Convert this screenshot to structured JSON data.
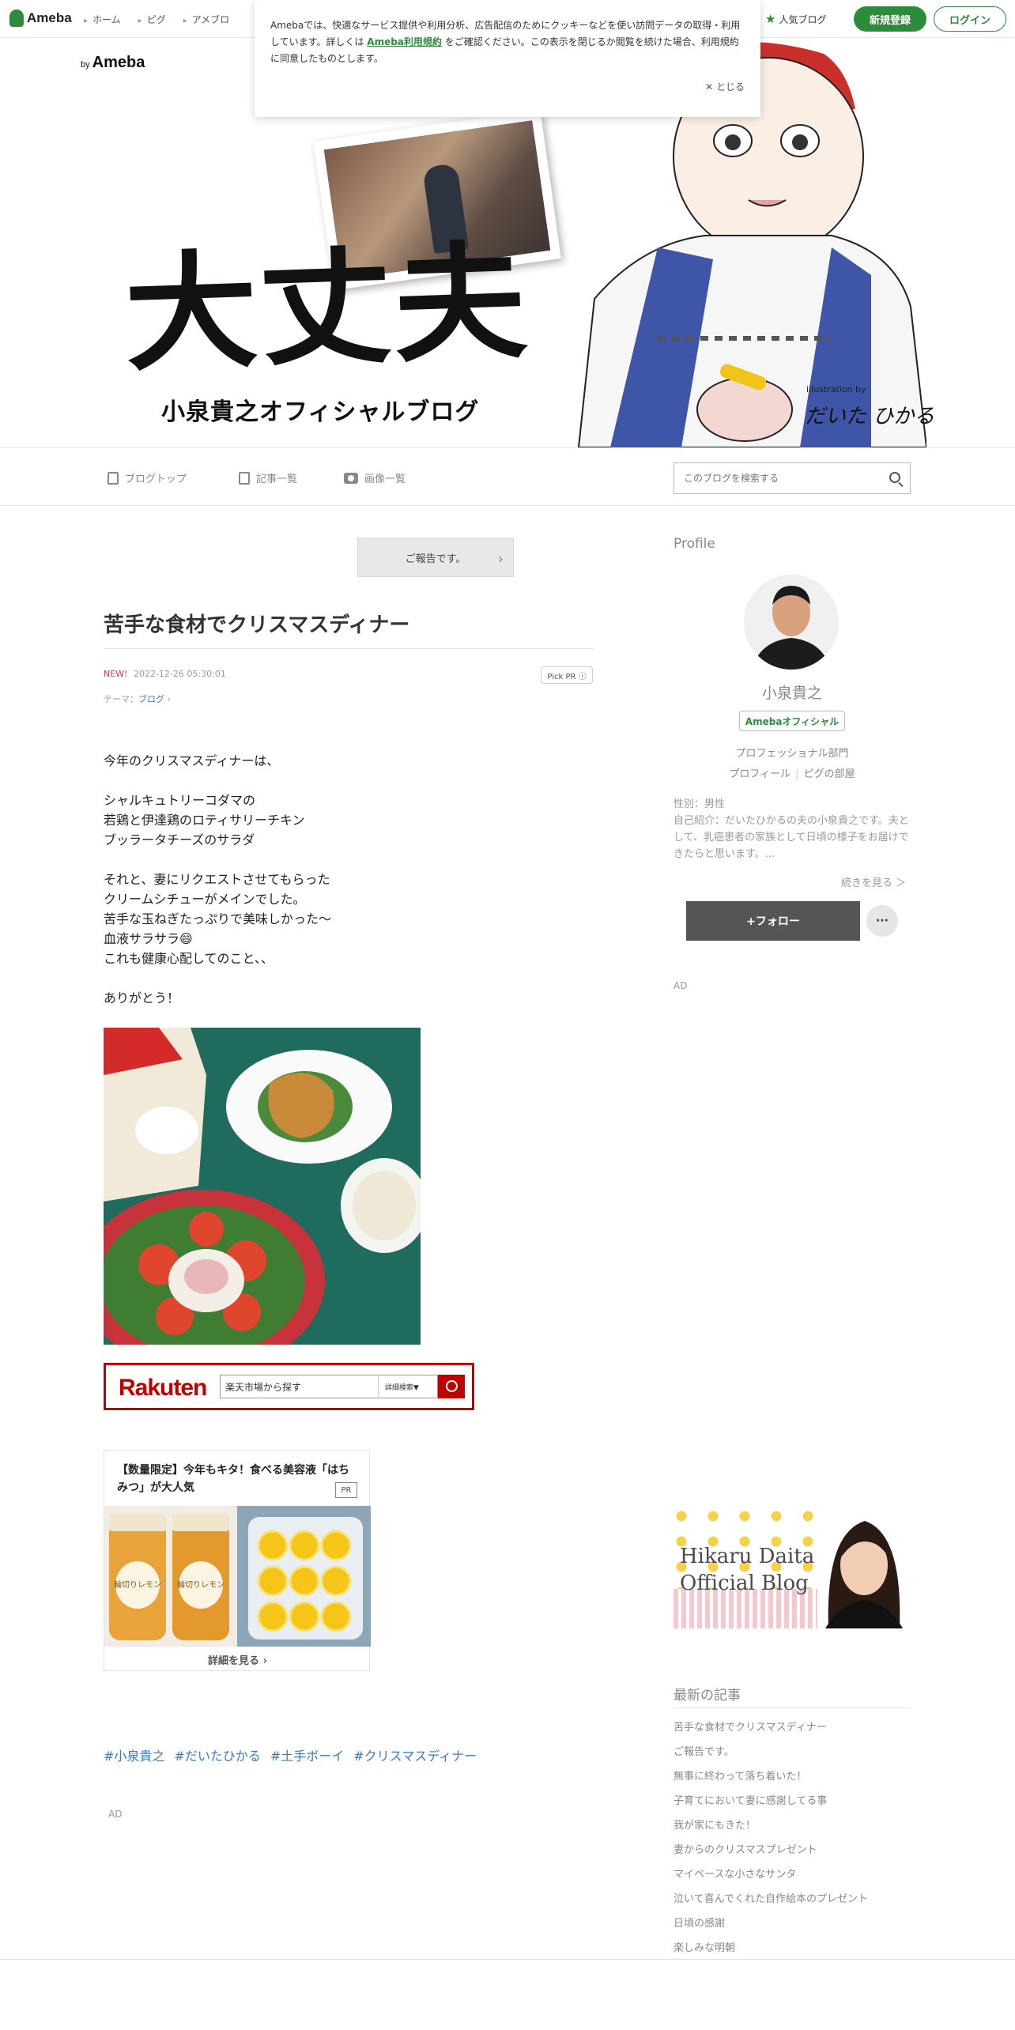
{
  "topnav": {
    "logo": "Ameba",
    "links": [
      "ホーム",
      "ピグ",
      "アメブロ"
    ],
    "popular": "人気ブログ",
    "signup": "新規登録",
    "login": "ログイン"
  },
  "header": {
    "by_label": "by",
    "by_brand": "Ameba",
    "title": "大丈夫",
    "subtitle": "小泉貴之オフィシャルブログ",
    "credit_small": "illustration by",
    "credit_sig": "だいた ひかる"
  },
  "cookie": {
    "text_before": "Amebaでは、快適なサービス提供や利用分析、広告配信のためにクッキーなどを使い訪問データの取得・利用しています。詳しくは",
    "link": "Ameba利用規約",
    "text_after": "をご確認ください。この表示を閉じるか閲覧を続けた場合、利用規約に同意したものとします。",
    "close": "とじる"
  },
  "blognav": {
    "top": "ブログトップ",
    "entries": "記事一覧",
    "images": "画像一覧",
    "search_placeholder": "このブログを検索する"
  },
  "entry": {
    "prev": "ご報告です。",
    "title": "苦手な食材でクリスマスディナー",
    "new": "NEW!",
    "date": "2022-12-26 05:30:01",
    "pickpr": "Pick PR ⓘ",
    "theme_label": "テーマ：",
    "theme": "ブログ",
    "paragraphs": [
      [
        "今年のクリスマスディナーは、"
      ],
      [
        "シャルキュトリーコダマの",
        "若鶏と伊達鶏のロティサリーチキン",
        "ブッラータチーズのサラダ"
      ],
      [
        "それと、妻にリクエストさせてもらった",
        "クリームシチューがメインでした。",
        "苦手な玉ねぎたっぷりで美味しかった〜",
        "血液サラサラ😄",
        "これも健康心配してのこと、、"
      ],
      [
        "ありがとう！"
      ]
    ],
    "hashtags": [
      "#小泉貴之",
      "#だいたひかる",
      "#土手ボーイ",
      "#クリスマスディナー"
    ],
    "ad_label": "AD"
  },
  "rakuten": {
    "logo": "Rakuten",
    "placeholder": "楽天市場から探す",
    "detail": "詳細検索▼"
  },
  "ad_card": {
    "title": "【数量限定】今年もキタ！食べる美容液「はちみつ」が大人気",
    "pr": "PR",
    "jar_label": "輪切りレモン",
    "more": "詳細を見る"
  },
  "profile": {
    "heading": "Profile",
    "name": "小泉貴之",
    "official": "Amebaオフィシャル",
    "category": "プロフェッショナル部門",
    "link_profile": "プロフィール",
    "link_room": "ピグの部屋",
    "gender": "性別：男性",
    "intro": "自己紹介：だいたひかるの夫の小泉貴之です。夫として、乳癌患者の家族として日頃の様子をお届けできたらと思います。...",
    "readmore": "続きを見る ＞",
    "follow": "+フォロー",
    "more": "···",
    "ad_label": "AD"
  },
  "banner": {
    "line1": "Hikaru Daita",
    "line2": "Official Blog"
  },
  "latest": {
    "heading": "最新の記事",
    "items": [
      "苦手な食材でクリスマスディナー",
      "ご報告です。",
      "無事に終わって落ち着いた！",
      "子育てにおいて妻に感謝してる事",
      "我が家にもきた！",
      "妻からのクリスマスプレゼント",
      "マイペースな小さなサンタ",
      "泣いて喜んでくれた自作絵本のプレゼント",
      "日頃の感謝",
      "楽しみな明朝"
    ]
  }
}
